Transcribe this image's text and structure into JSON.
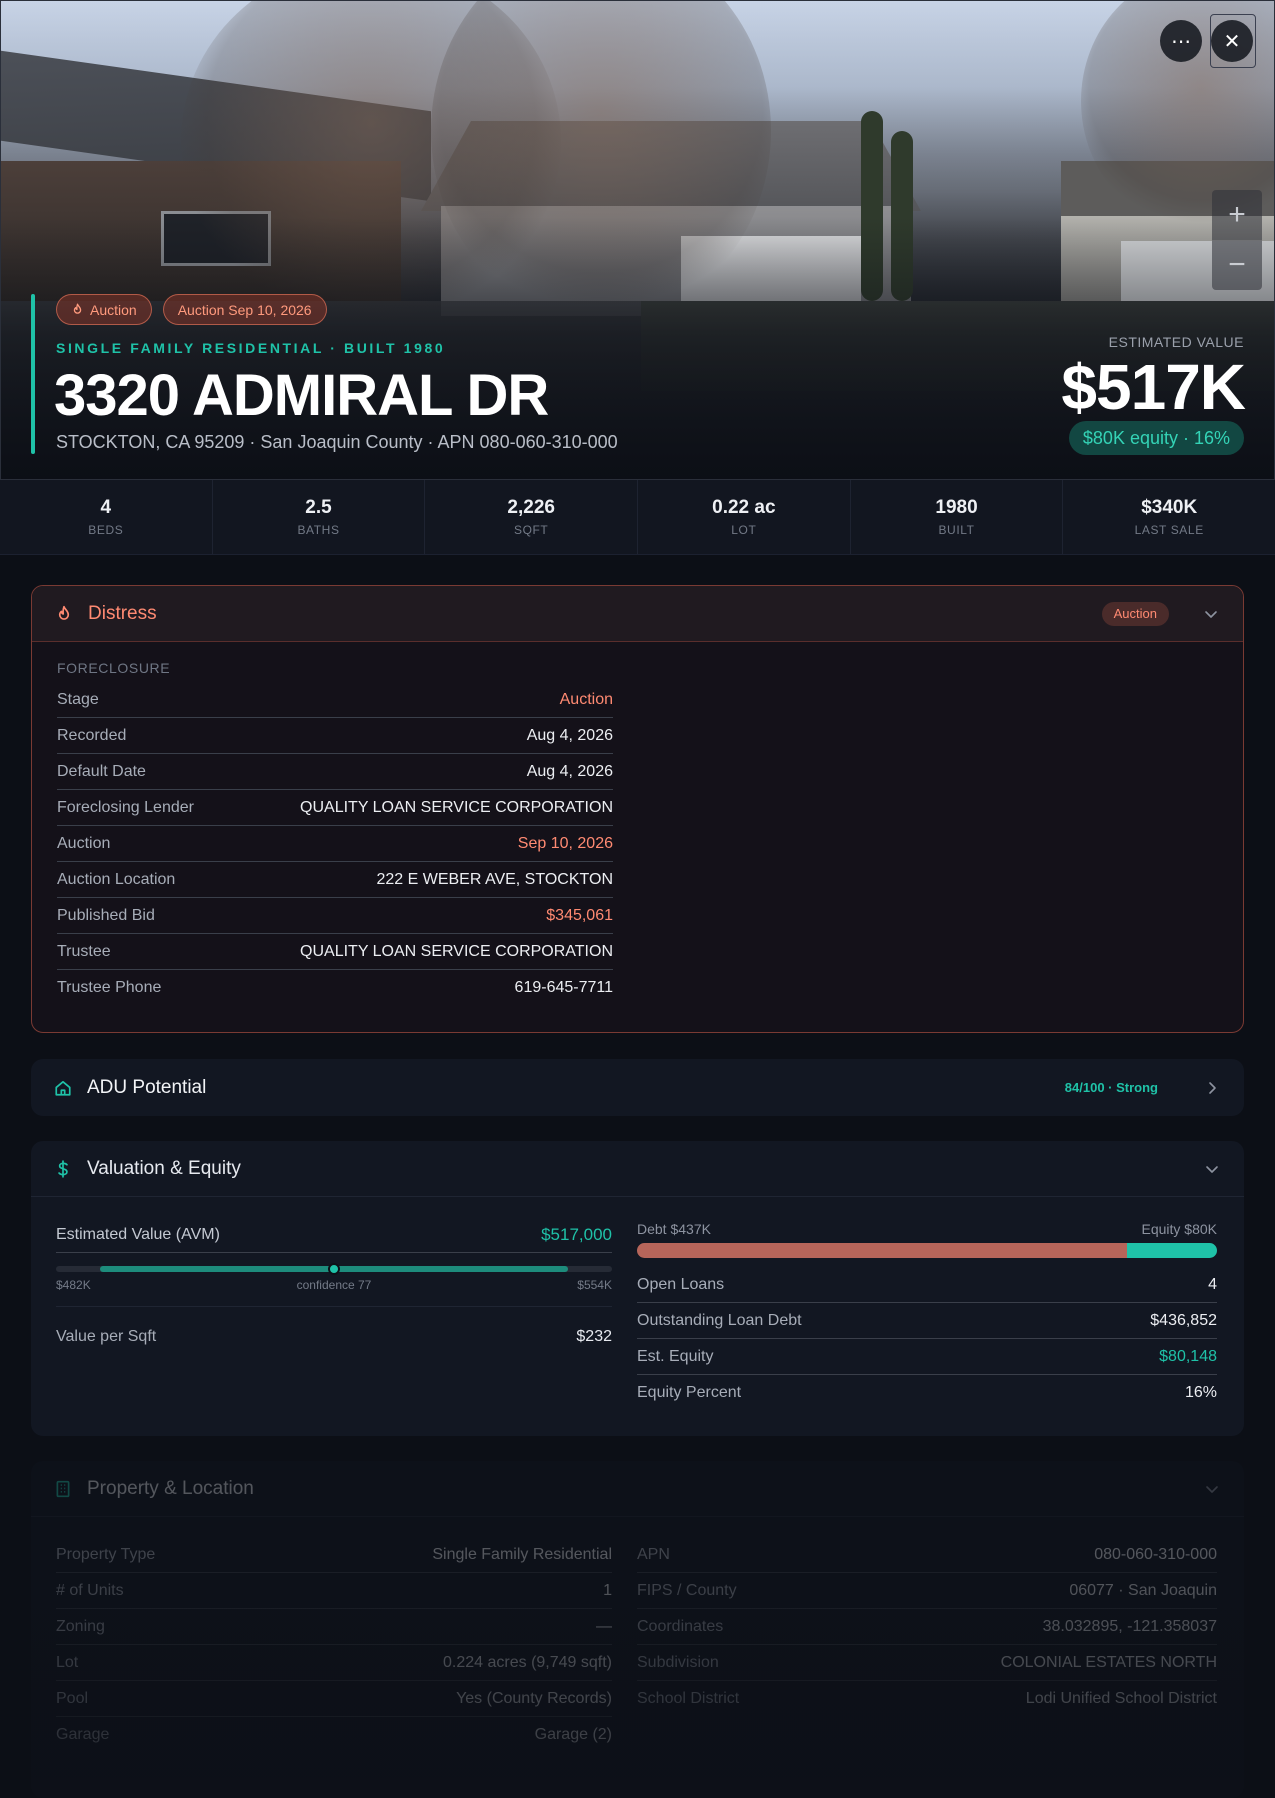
{
  "hero": {
    "chips": [
      {
        "label": "Auction",
        "icon": "flame-icon"
      },
      {
        "label": "Auction Sep 10, 2026"
      }
    ],
    "subtype": "SINGLE FAMILY RESIDENTIAL · BUILT 1980",
    "address": "3320 ADMIRAL DR",
    "address_sub": "STOCKTON, CA 95209 · San Joaquin County · APN 080-060-310-000",
    "estimated_label": "ESTIMATED VALUE",
    "estimated_value": "$517K",
    "equity_pill": "$80K equity · 16%",
    "more_icon": "⋯",
    "close_icon": "✕",
    "zoom_in": "+",
    "zoom_out": "−"
  },
  "stats": [
    {
      "value": "4",
      "label": "BEDS"
    },
    {
      "value": "2.5",
      "label": "BATHS"
    },
    {
      "value": "2,226",
      "label": "SQFT"
    },
    {
      "value": "0.22 ac",
      "label": "LOT"
    },
    {
      "value": "1980",
      "label": "BUILT"
    },
    {
      "value": "$340K",
      "label": "LAST SALE"
    }
  ],
  "distress": {
    "title": "Distress",
    "badge": "Auction",
    "section": "FORECLOSURE",
    "rows": [
      {
        "k": "Stage",
        "v": "Auction",
        "tone": "red"
      },
      {
        "k": "Recorded",
        "v": "Aug 4, 2026",
        "tone": ""
      },
      {
        "k": "Default Date",
        "v": "Aug 4, 2026",
        "tone": ""
      },
      {
        "k": "Foreclosing Lender",
        "v": "QUALITY LOAN SERVICE CORPORATION",
        "tone": ""
      },
      {
        "k": "Auction",
        "v": "Sep 10, 2026",
        "tone": "red"
      },
      {
        "k": "Auction Location",
        "v": "222 E WEBER AVE, STOCKTON",
        "tone": ""
      },
      {
        "k": "Published Bid",
        "v": "$345,061",
        "tone": "red"
      },
      {
        "k": "Trustee",
        "v": "QUALITY LOAN SERVICE CORPORATION",
        "tone": ""
      },
      {
        "k": "Trustee Phone",
        "v": "619-645-7711",
        "tone": ""
      }
    ]
  },
  "adu": {
    "title": "ADU Potential",
    "score": "84/100 · Strong"
  },
  "valuation": {
    "title": "Valuation & Equity",
    "avm_label": "Estimated Value (AVM)",
    "avm_value": "$517,000",
    "range_low": "$482K",
    "range_mid": "confidence 77",
    "range_high": "$554K",
    "range_fill_start_pct": 8,
    "range_fill_end_pct": 92,
    "range_marker_pct": 50,
    "value_per_sqft_label": "Value per Sqft",
    "value_per_sqft": "$232",
    "debt_label": "Debt $437K",
    "equity_label": "Equity $80K",
    "debt_fraction": 0.845,
    "rows": [
      {
        "k": "Open Loans",
        "v": "4",
        "tone": ""
      },
      {
        "k": "Outstanding Loan Debt",
        "v": "$436,852",
        "tone": ""
      },
      {
        "k": "Est. Equity",
        "v": "$80,148",
        "tone": "teal"
      },
      {
        "k": "Equity Percent",
        "v": "16%",
        "tone": ""
      }
    ]
  },
  "property": {
    "title": "Property & Location",
    "left": [
      {
        "k": "Property Type",
        "v": "Single Family Residential"
      },
      {
        "k": "# of Units",
        "v": "1"
      },
      {
        "k": "Zoning",
        "v": "—"
      },
      {
        "k": "Lot",
        "v": "0.224 acres (9,749 sqft)"
      },
      {
        "k": "Pool",
        "v": "Yes (County Records)"
      },
      {
        "k": "Garage",
        "v": "Garage (2)"
      }
    ],
    "right": [
      {
        "k": "APN",
        "v": "080-060-310-000"
      },
      {
        "k": "FIPS / County",
        "v": "06077 · San Joaquin"
      },
      {
        "k": "Coordinates",
        "v": "38.032895, -121.358037"
      },
      {
        "k": "Subdivision",
        "v": "COLONIAL ESTATES NORTH"
      },
      {
        "k": "School District",
        "v": "Lodi Unified School District"
      }
    ]
  },
  "colors": {
    "accent": "#1fc2a8",
    "distress": "#ff8a72",
    "debt": "#b6655a"
  }
}
